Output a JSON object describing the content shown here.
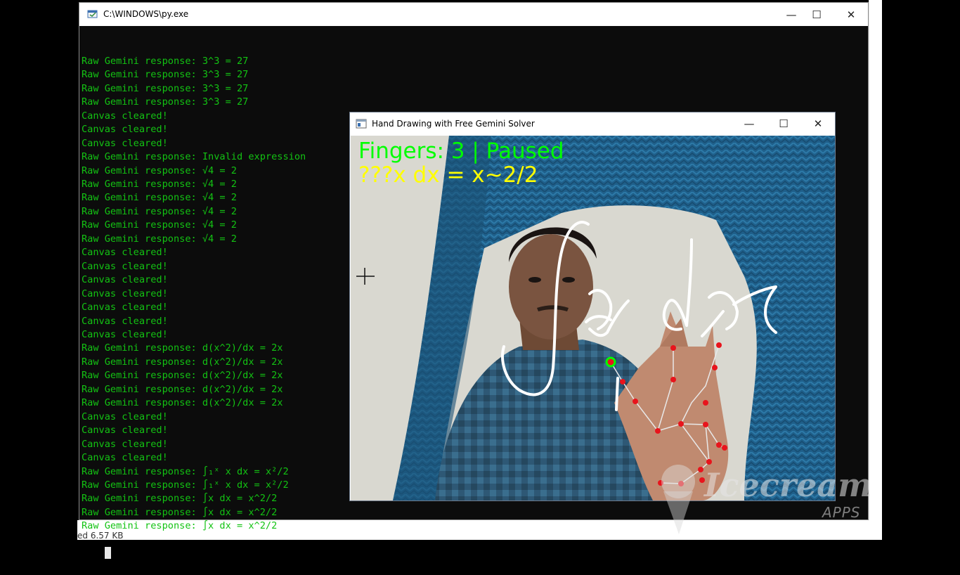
{
  "console": {
    "title": "C:\\WINDOWS\\py.exe",
    "lines": [
      "Raw Gemini response: 3^3 = 27",
      "Raw Gemini response: 3^3 = 27",
      "Raw Gemini response: 3^3 = 27",
      "Raw Gemini response: 3^3 = 27",
      "Canvas cleared!",
      "Canvas cleared!",
      "Canvas cleared!",
      "Raw Gemini response: Invalid expression",
      "Raw Gemini response: √4 = 2",
      "Raw Gemini response: √4 = 2",
      "Raw Gemini response: √4 = 2",
      "Raw Gemini response: √4 = 2",
      "Raw Gemini response: √4 = 2",
      "Raw Gemini response: √4 = 2",
      "Canvas cleared!",
      "Canvas cleared!",
      "Canvas cleared!",
      "Canvas cleared!",
      "Canvas cleared!",
      "Canvas cleared!",
      "Canvas cleared!",
      "Raw Gemini response: d(x^2)/dx = 2x",
      "Raw Gemini response: d(x^2)/dx = 2x",
      "Raw Gemini response: d(x^2)/dx = 2x",
      "Raw Gemini response: d(x^2)/dx = 2x",
      "Raw Gemini response: d(x^2)/dx = 2x",
      "Canvas cleared!",
      "Canvas cleared!",
      "Canvas cleared!",
      "Canvas cleared!",
      "Raw Gemini response: ∫₁ˣ x dx = x²/2",
      "Raw Gemini response: ∫₁ˣ x dx = x²/2",
      "Raw Gemini response: ∫x dx = x^2/2",
      "Raw Gemini response: ∫x dx = x^2/2",
      "Raw Gemini response: ∫x dx = x^2/2"
    ]
  },
  "cv_window": {
    "title": "Hand Drawing with Free Gemini Solver",
    "status_text": "Fingers: 3 | Paused",
    "result_text": "???x dx = x~2/2",
    "status_color": "#00ff00",
    "result_color": "#ffff00"
  },
  "window_controls": {
    "minimize": "—",
    "maximize": "☐",
    "close": "✕"
  },
  "bottom_strip_text": "ed  6.57 KB",
  "watermark": {
    "brand": "Icecream",
    "sub": "APPS"
  },
  "icons": [
    "console-app-icon",
    "opencv-window-icon",
    "crosshair-cursor-icon",
    "minimize-icon",
    "maximize-icon",
    "close-icon"
  ]
}
